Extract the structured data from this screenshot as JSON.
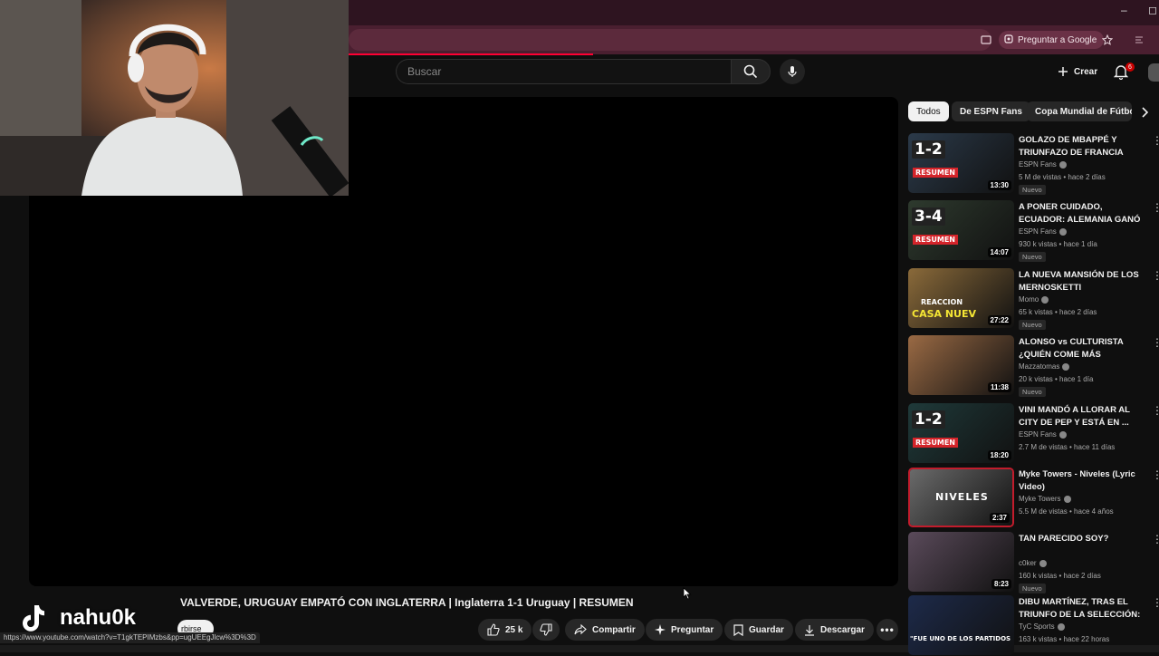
{
  "browser": {
    "gemini_label": "Preguntar a Google",
    "status_url": "https://www.youtube.com/watch?v=T1gkTEPIMzbs&pp=ugUEEgJlcw%3D%3D"
  },
  "header": {
    "search_placeholder": "Buscar",
    "create_label": "Crear",
    "notif_count": "6"
  },
  "video": {
    "title": "VALVERDE, URUGUAY EMPATÓ CON INGLATERRA | Inglaterra 1-1 Uruguay | RESUMEN",
    "subscribe_partial": "rbirse",
    "likes": "25 k",
    "actions": {
      "share": "Compartir",
      "ask": "Preguntar",
      "save": "Guardar",
      "download": "Descargar"
    }
  },
  "overlay": {
    "tiktok_handle": "nahu0k"
  },
  "chips": [
    "Todos",
    "De ESPN Fans",
    "Copa Mundial de Fútbo"
  ],
  "recommendations": [
    {
      "title": "GOLAZO DE MBAPPÉ Y TRIUNFAZO DE FRANCIA ANT...",
      "channel": "ESPN Fans",
      "meta": "5 M de vistas • hace 2 días",
      "badge": "Nuevo",
      "duration": "13:30",
      "thumb_text": "1-2",
      "thumb_sub": "RESUMEN",
      "thumb_color": "#2b3a4a"
    },
    {
      "title": "A PONER CUIDADO, ECUADOR: ALEMANIA GANÓ CON UN ...",
      "channel": "ESPN Fans",
      "meta": "930 k vistas • hace 1 día",
      "badge": "Nuevo",
      "duration": "14:07",
      "thumb_text": "3-4",
      "thumb_sub": "RESUMEN",
      "thumb_color": "#2e3a2e"
    },
    {
      "title": "LA NUEVA MANSIÓN DE LOS MERNOSKETTI",
      "channel": "Momo",
      "meta": "65 k vistas • hace 2 días",
      "badge": "Nuevo",
      "duration": "27:22",
      "thumb_text": "CASA NUEV",
      "thumb_sub": "REACCION",
      "thumb_color": "#8a6a3a"
    },
    {
      "title": "ALONSO vs CULTURISTA ¿QUIÉN COME MÁS PANCHOS?",
      "channel": "Mazzatomas",
      "meta": "20 k vistas • hace 1 día",
      "badge": "Nuevo",
      "duration": "11:38",
      "thumb_text": "",
      "thumb_sub": "",
      "thumb_color": "#9a6a44"
    },
    {
      "title": "VINI MANDÓ A LLORAR AL CITY DE PEP Y ESTÁ EN ...",
      "channel": "ESPN Fans",
      "meta": "2.7 M de vistas • hace 11 días",
      "badge": "",
      "duration": "18:20",
      "thumb_text": "1-2",
      "thumb_sub": "RESUMEN",
      "thumb_color": "#1f3a3a"
    },
    {
      "title": "Myke Towers - Niveles (Lyric Video)",
      "channel": "Myke Towers",
      "meta": "5.5 M de vistas • hace 4 años",
      "badge": "",
      "duration": "2:37",
      "thumb_text": "NIVELES",
      "thumb_sub": "",
      "thumb_color": "#6a6a6a"
    },
    {
      "title": "TAN PARECIDO SOY?",
      "channel": "c0ker",
      "meta": "160 k vistas • hace 2 días",
      "badge": "Nuevo",
      "duration": "8:23",
      "thumb_text": "",
      "thumb_sub": "",
      "thumb_color": "#5a4a5a"
    },
    {
      "title": "DIBU MARTÍNEZ, TRAS EL TRIUNFO DE LA SELECCIÓN: ...",
      "channel": "TyC Sports",
      "meta": "163 k vistas • hace 22 horas",
      "badge": "",
      "duration": "",
      "thumb_text": "\"FUE UNO DE LOS PARTIDOS",
      "thumb_sub": "",
      "thumb_color": "#1d2a4a"
    }
  ]
}
